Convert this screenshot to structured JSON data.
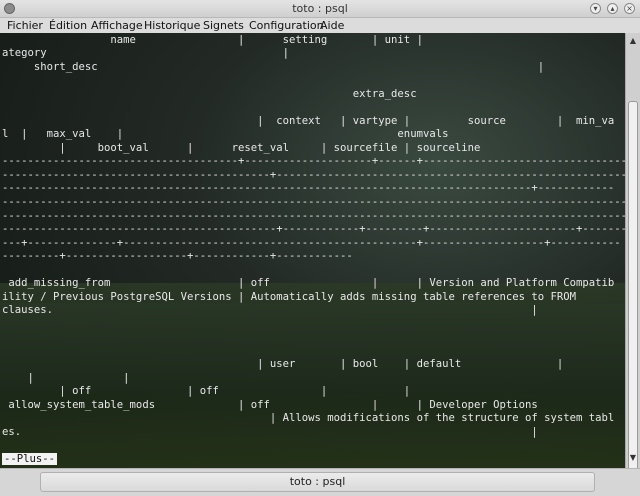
{
  "window": {
    "title": "toto : psql"
  },
  "menubar": {
    "items": [
      "Fichier",
      "Édition",
      "Affichage",
      "Historique",
      "Signets",
      "Configuration",
      "Aide"
    ]
  },
  "terminal": {
    "lines": [
      "                 name                |      setting       | unit |                                c",
      "ategory                                     |",
      "     short_desc                                                                     |",
      "",
      "                                                       extra_desc",
      "",
      "                                        |  context   | vartype |         source        |  min_va",
      "l  |   max_val    |                                           enumvals",
      "         |     boot_val      |      reset_val     | sourcefile | sourceline",
      "-------------------------------------+--------------------+------+----------------------------------",
      "------------------------------------------+-------------------------------------------------------",
      "-----------------------------------------------------------------------------------+------------",
      "---------------------------------------------------------------------------------------------------",
      "---------------------------------------------------------------------------------------------------",
      "-------------------------------------------+------------+---------+-----------------------+---------",
      "---+--------------+----------------------------------------------+-------------------+-----------",
      "---------+-------------------+------------+------------",
      " add_missing_from                    | off                |      | Version and Platform Compatib",
      "ility / Previous PostgreSQL Versions | Automatically adds missing table references to FROM",
      "clauses.                                                                           |",
      "",
      "",
      "",
      "                                        | user       | bool    | default               |",
      "    |              |",
      "         | off               | off                |            |",
      " allow_system_table_mods             | off                |      | Developer Options",
      "                                          | Allows modifications of the structure of system tabl",
      "es.                                                                                |",
      ""
    ],
    "pager_prompt": "--Plus--"
  },
  "tabbar": {
    "tab_label": "toto : psql"
  }
}
